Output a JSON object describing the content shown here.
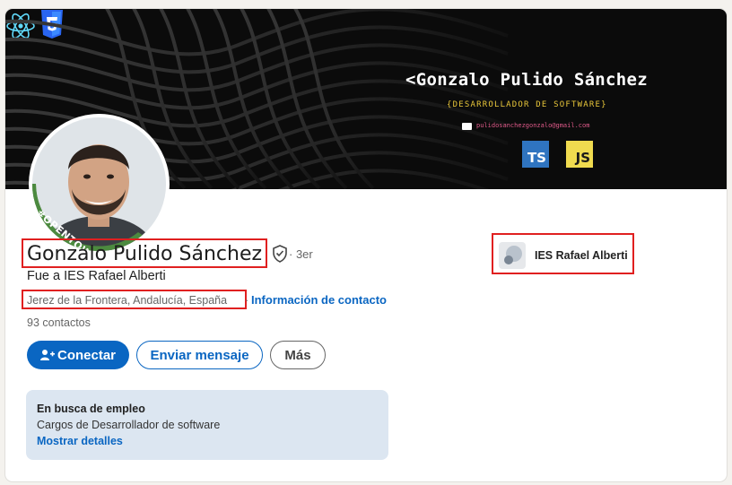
{
  "banner": {
    "name": "Gonzalo Pulido Sánchez",
    "role": "{DESARROLLADOR DE SOFTWARE}",
    "email": "pulidosanchezgonzalo@gmail.com",
    "tech": {
      "ts": "TS",
      "js": "JS"
    }
  },
  "avatar": {
    "badge": "#OPENTOWORK"
  },
  "profile": {
    "name": "Gonzalo Pulido Sánchez",
    "degree": "· 3er",
    "headline": "Fue a IES Rafael Alberti",
    "location": "Jerez de la Frontera, Andalucía, España",
    "dot": "·",
    "contact_link": "Información de contacto",
    "connections": "93 contactos"
  },
  "buttons": {
    "connect": "Conectar",
    "message": "Enviar mensaje",
    "more": "Más"
  },
  "open_to_work": {
    "title": "En busca de empleo",
    "roles": "Cargos de Desarrollador de software",
    "details_link": "Mostrar detalles"
  },
  "education": {
    "school": "IES Rafael Alberti"
  },
  "colors": {
    "accent": "#0a66c2",
    "highlight_box": "#e02020",
    "open_to_work_bg": "#dce6f1",
    "banner_bg": "#0b0b0b"
  }
}
